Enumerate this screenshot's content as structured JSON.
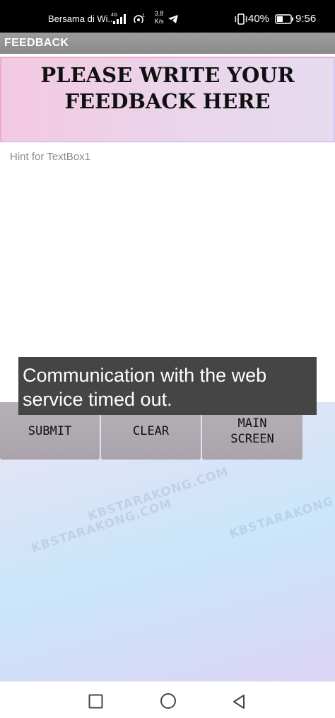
{
  "status_bar": {
    "carrier": "Bersama di Wi...",
    "network_type": "4G",
    "hotspot_badge": "1",
    "speed_value": "3.8",
    "speed_unit": "K/s",
    "battery_percent": "40%",
    "time": "9:56",
    "icons": [
      "signal-icon",
      "hotspot-icon",
      "telegram-icon",
      "vibrate-icon",
      "battery-icon"
    ]
  },
  "title_bar": {
    "title": "FEEDBACK"
  },
  "banner": {
    "line1": "PLEASE WRITE YOUR",
    "line2": "FEEDBACK HERE"
  },
  "textbox": {
    "placeholder": "Hint for TextBox1",
    "value": ""
  },
  "buttons": {
    "submit": "SUBMIT",
    "clear": "CLEAR",
    "main_line1": "MAIN",
    "main_line2": "SCREEN"
  },
  "toast": {
    "message": "Communication with the web service timed out."
  },
  "watermarks": [
    "KBSTARAKONG.COM",
    "KBSTARAKONG.COM",
    "KBSTARAKONG.COM"
  ],
  "nav_bar": {
    "icons": [
      "recent-apps-icon",
      "home-icon",
      "back-icon"
    ]
  },
  "colors": {
    "toast_bg": "#454545",
    "button_bg": "#aaa3ab",
    "title_bar_bg": "#9a9a9a"
  }
}
